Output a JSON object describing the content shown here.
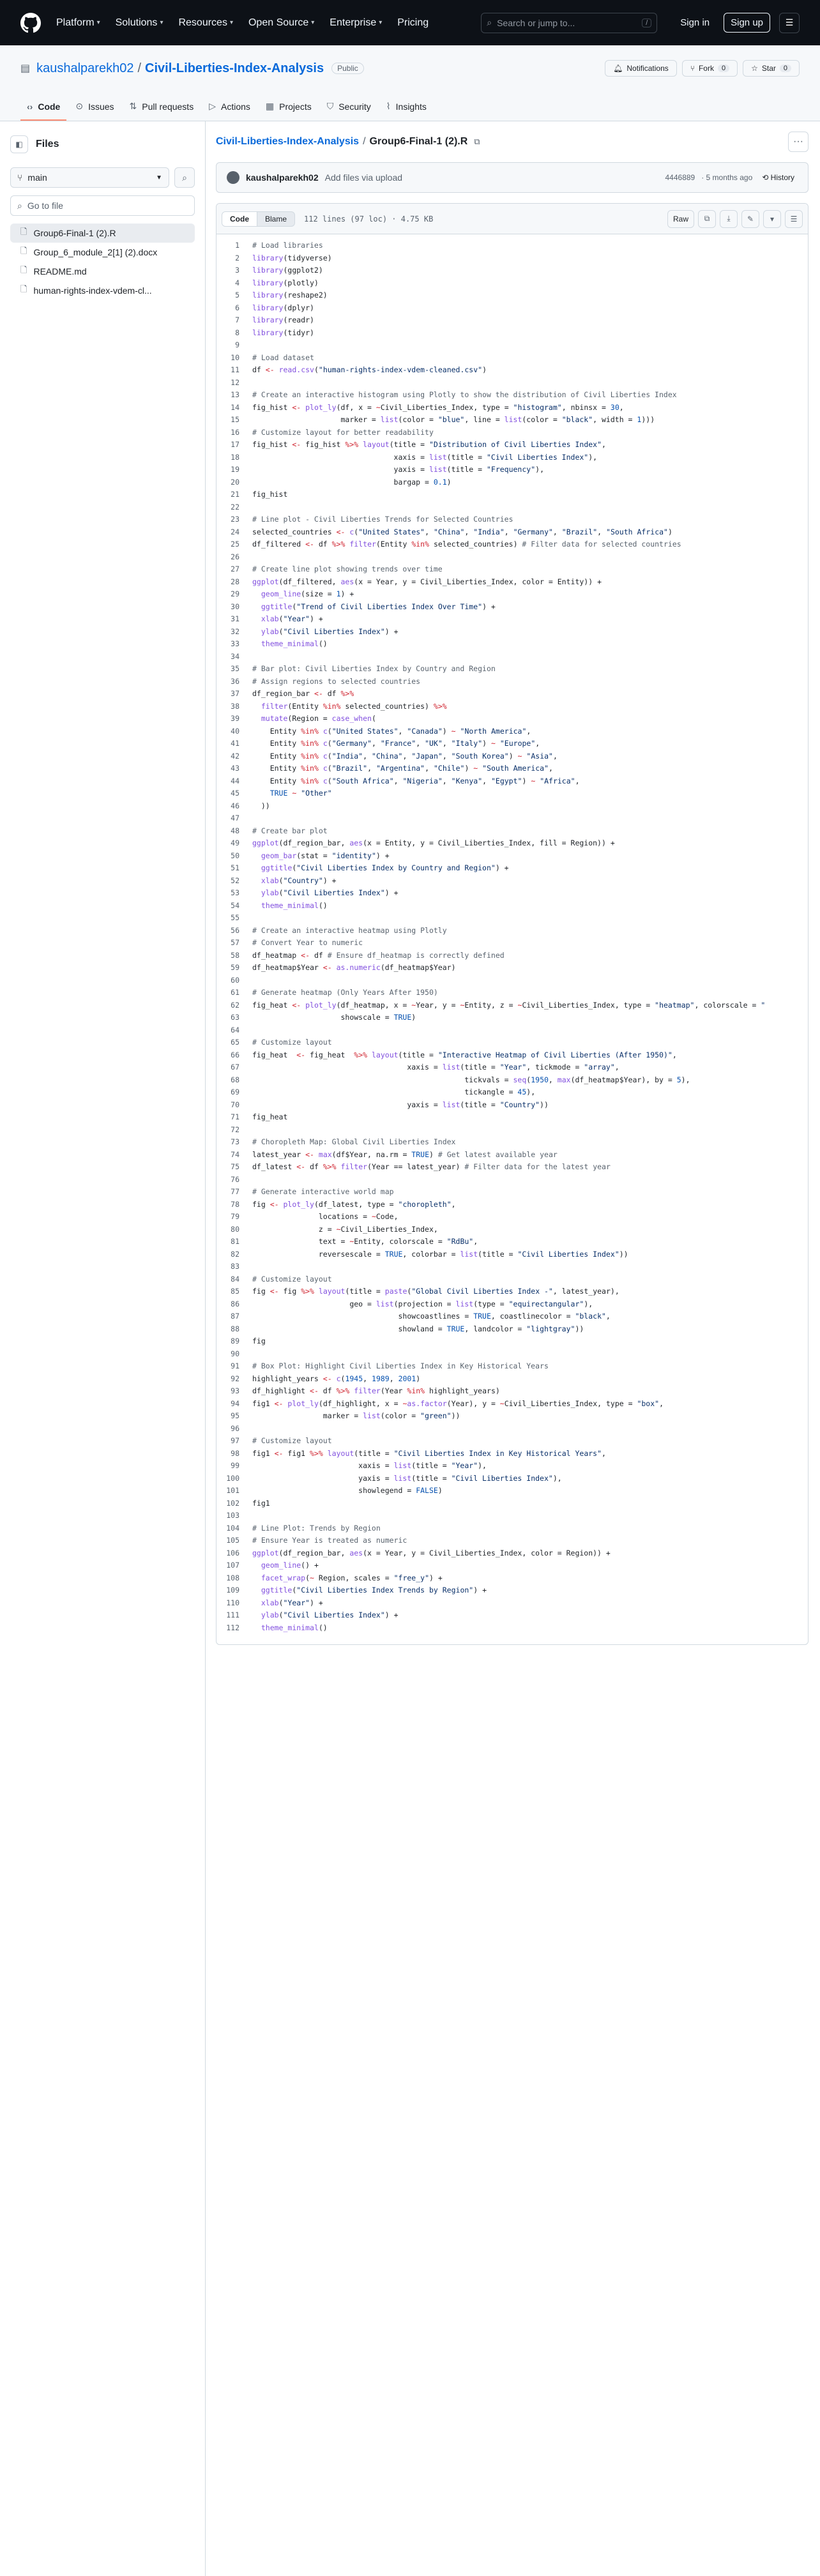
{
  "nav": {
    "items": [
      {
        "label": "Platform"
      },
      {
        "label": "Solutions"
      },
      {
        "label": "Resources"
      },
      {
        "label": "Open Source"
      },
      {
        "label": "Enterprise"
      },
      {
        "label": "Pricing"
      }
    ],
    "search_placeholder": "Search or jump to...",
    "search_shortcut": "/",
    "signin": "Sign in",
    "signup": "Sign up"
  },
  "repo": {
    "owner": "kaushalparekh02",
    "separator": "/",
    "name": "Civil-Liberties-Index-Analysis",
    "visibility": "Public",
    "notifications": "Notifications",
    "fork": "Fork",
    "fork_count": "0",
    "star": "Star",
    "star_count": "0"
  },
  "tabs": [
    {
      "label": "Code",
      "icon": "code-icon"
    },
    {
      "label": "Issues",
      "icon": "issue-icon"
    },
    {
      "label": "Pull requests",
      "icon": "pull-request-icon"
    },
    {
      "label": "Actions",
      "icon": "play-icon"
    },
    {
      "label": "Projects",
      "icon": "table-icon"
    },
    {
      "label": "Security",
      "icon": "shield-icon"
    },
    {
      "label": "Insights",
      "icon": "graph-icon"
    }
  ],
  "sidebar": {
    "title": "Files",
    "branch": "main",
    "goto_placeholder": "Go to file",
    "files": [
      {
        "name": "Group6-Final-1 (2).R",
        "selected": true
      },
      {
        "name": "Group_6_module_2[1] (2).docx",
        "selected": false
      },
      {
        "name": "README.md",
        "selected": false
      },
      {
        "name": "human-rights-index-vdem-cl...",
        "selected": false
      }
    ]
  },
  "breadcrumb": {
    "repo": "Civil-Liberties-Index-Analysis",
    "sep": "/",
    "file": "Group6-Final-1 (2).R"
  },
  "commit": {
    "author": "kaushalparekh02",
    "message": "Add files via upload",
    "hash": "4446889",
    "time": "· 5 months ago",
    "history": "History"
  },
  "file": {
    "tab_code": "Code",
    "tab_blame": "Blame",
    "info": "112 lines (97 loc) · 4.75 KB",
    "raw": "Raw"
  },
  "code": [
    "# Load libraries",
    "library(tidyverse)",
    "library(ggplot2)",
    "library(plotly)",
    "library(reshape2)",
    "library(dplyr)",
    "library(readr)",
    "library(tidyr)",
    "",
    "# Load dataset",
    "df <- read.csv(\"human-rights-index-vdem-cleaned.csv\")",
    "",
    "# Create an interactive histogram using Plotly to show the distribution of Civil Liberties Index",
    "fig_hist <- plot_ly(df, x = ~Civil_Liberties_Index, type = \"histogram\", nbinsx = 30,",
    "                    marker = list(color = \"blue\", line = list(color = \"black\", width = 1)))",
    "# Customize layout for better readability",
    "fig_hist <- fig_hist %>% layout(title = \"Distribution of Civil Liberties Index\",",
    "                                xaxis = list(title = \"Civil Liberties Index\"),",
    "                                yaxis = list(title = \"Frequency\"),",
    "                                bargap = 0.1)",
    "fig_hist",
    "",
    "# Line plot - Civil Liberties Trends for Selected Countries",
    "selected_countries <- c(\"United States\", \"China\", \"India\", \"Germany\", \"Brazil\", \"South Africa\")",
    "df_filtered <- df %>% filter(Entity %in% selected_countries) # Filter data for selected countries",
    "",
    "# Create line plot showing trends over time",
    "ggplot(df_filtered, aes(x = Year, y = Civil_Liberties_Index, color = Entity)) +",
    "  geom_line(size = 1) +",
    "  ggtitle(\"Trend of Civil Liberties Index Over Time\") +",
    "  xlab(\"Year\") +",
    "  ylab(\"Civil Liberties Index\") +",
    "  theme_minimal()",
    "",
    "# Bar plot: Civil Liberties Index by Country and Region",
    "# Assign regions to selected countries",
    "df_region_bar <- df %>%",
    "  filter(Entity %in% selected_countries) %>%",
    "  mutate(Region = case_when(",
    "    Entity %in% c(\"United States\", \"Canada\") ~ \"North America\",",
    "    Entity %in% c(\"Germany\", \"France\", \"UK\", \"Italy\") ~ \"Europe\",",
    "    Entity %in% c(\"India\", \"China\", \"Japan\", \"South Korea\") ~ \"Asia\",",
    "    Entity %in% c(\"Brazil\", \"Argentina\", \"Chile\") ~ \"South America\",",
    "    Entity %in% c(\"South Africa\", \"Nigeria\", \"Kenya\", \"Egypt\") ~ \"Africa\",",
    "    TRUE ~ \"Other\"",
    "  ))",
    "",
    "# Create bar plot",
    "ggplot(df_region_bar, aes(x = Entity, y = Civil_Liberties_Index, fill = Region)) +",
    "  geom_bar(stat = \"identity\") +",
    "  ggtitle(\"Civil Liberties Index by Country and Region\") +",
    "  xlab(\"Country\") +",
    "  ylab(\"Civil Liberties Index\") +",
    "  theme_minimal()",
    "",
    "# Create an interactive heatmap using Plotly",
    "# Convert Year to numeric",
    "df_heatmap <- df # Ensure df_heatmap is correctly defined",
    "df_heatmap$Year <- as.numeric(df_heatmap$Year)",
    "",
    "# Generate heatmap (Only Years After 1950)",
    "fig_heat <- plot_ly(df_heatmap, x = ~Year, y = ~Entity, z = ~Civil_Liberties_Index, type = \"heatmap\", colorscale = \"",
    "                    showscale = TRUE)",
    "",
    "# Customize layout",
    "fig_heat  <- fig_heat  %>% layout(title = \"Interactive Heatmap of Civil Liberties (After 1950)\",",
    "                                   xaxis = list(title = \"Year\", tickmode = \"array\",",
    "                                                tickvals = seq(1950, max(df_heatmap$Year), by = 5),",
    "                                                tickangle = 45),",
    "                                   yaxis = list(title = \"Country\"))",
    "fig_heat",
    "",
    "# Choropleth Map: Global Civil Liberties Index",
    "latest_year <- max(df$Year, na.rm = TRUE) # Get latest available year",
    "df_latest <- df %>% filter(Year == latest_year) # Filter data for the latest year",
    "",
    "# Generate interactive world map",
    "fig <- plot_ly(df_latest, type = \"choropleth\",",
    "               locations = ~Code,",
    "               z = ~Civil_Liberties_Index,",
    "               text = ~Entity, colorscale = \"RdBu\",",
    "               reversescale = TRUE, colorbar = list(title = \"Civil Liberties Index\"))",
    "",
    "# Customize layout",
    "fig <- fig %>% layout(title = paste(\"Global Civil Liberties Index -\", latest_year),",
    "                      geo = list(projection = list(type = \"equirectangular\"),",
    "                                 showcoastlines = TRUE, coastlinecolor = \"black\",",
    "                                 showland = TRUE, landcolor = \"lightgray\"))",
    "fig",
    "",
    "# Box Plot: Highlight Civil Liberties Index in Key Historical Years",
    "highlight_years <- c(1945, 1989, 2001)",
    "df_highlight <- df %>% filter(Year %in% highlight_years)",
    "fig1 <- plot_ly(df_highlight, x = ~as.factor(Year), y = ~Civil_Liberties_Index, type = \"box\",",
    "                marker = list(color = \"green\"))",
    "",
    "# Customize layout",
    "fig1 <- fig1 %>% layout(title = \"Civil Liberties Index in Key Historical Years\",",
    "                        xaxis = list(title = \"Year\"),",
    "                        yaxis = list(title = \"Civil Liberties Index\"),",
    "                        showlegend = FALSE)",
    "fig1",
    "",
    "# Line Plot: Trends by Region",
    "# Ensure Year is treated as numeric",
    "ggplot(df_region_bar, aes(x = Year, y = Civil_Liberties_Index, color = Region)) +",
    "  geom_line() +",
    "  facet_wrap(~ Region, scales = \"free_y\") +",
    "  ggtitle(\"Civil Liberties Index Trends by Region\") +",
    "  xlab(\"Year\") +",
    "  ylab(\"Civil Liberties Index\") +",
    "  theme_minimal()"
  ]
}
